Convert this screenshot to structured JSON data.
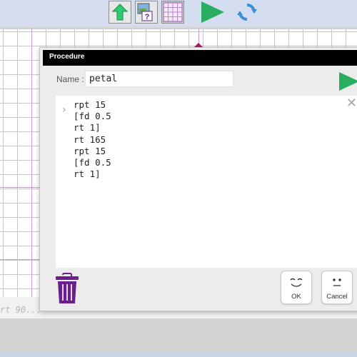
{
  "toolbar": {
    "buttons": [
      {
        "name": "up-arrow-icon"
      },
      {
        "name": "image-help-icon"
      },
      {
        "name": "grid-icon"
      },
      {
        "name": "play-icon"
      },
      {
        "name": "refresh-icon"
      }
    ],
    "colors": {
      "green": "#27ae60",
      "blue": "#3a8fd6",
      "purple": "#9b59b6"
    }
  },
  "command_line": {
    "hint": "rt 90..."
  },
  "dialog": {
    "title": "Procedure",
    "name_label": "Name :",
    "name_value": "petal",
    "code_lines": [
      "rpt 15",
      "[fd 0.5",
      "rt 1]",
      "rt 165",
      "rpt 15",
      "[fd 0.5",
      "rt 1]"
    ],
    "ok_label": "OK",
    "cancel_label": "Cancel",
    "colors": {
      "title_bg": "#000000",
      "trash": "#6a1f8c",
      "run": "#27ae60"
    }
  }
}
